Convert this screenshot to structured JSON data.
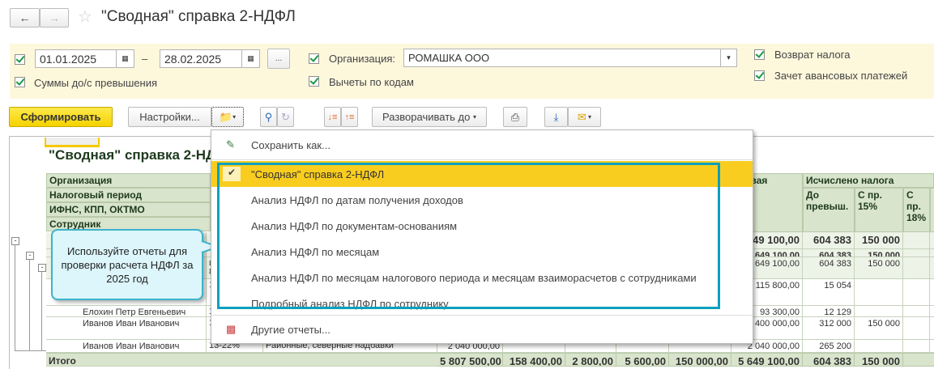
{
  "header": {
    "title": "\"Сводная\" справка 2-НДФЛ",
    "back_icon": "arrow-left",
    "forward_icon": "arrow-right",
    "favorite_icon": "star"
  },
  "filters": {
    "date_from": "01.01.2025",
    "dash": "–",
    "date_to": "28.02.2025",
    "period_button": "...",
    "org_label": "Организация:",
    "org_value": "РОМАШКА ООО",
    "sums_label": "Суммы до/с превышения",
    "deductions_label": "Вычеты по кодам",
    "refund_label": "Возврат налога",
    "advance_label": "Зачет авансовых платежей"
  },
  "toolbar": {
    "generate": "Сформировать",
    "settings": "Настройки...",
    "expand": "Разворачивать до"
  },
  "report": {
    "title": "\"Сводная\" справка 2-НДФЛ",
    "row_headers": [
      "Организация",
      "Налоговый период",
      "ИФНС, КПП, ОКТМО",
      "Сотрудник"
    ],
    "col_header_partial": "оговая",
    "col_header_partial2": "а",
    "tax_header": "Исчислено налога",
    "tax_sub": [
      "До превыш.",
      "С пр. 15%",
      "С пр. 18%"
    ],
    "rows": [
      {
        "name": "",
        "c2": "",
        "c3": "",
        "c1": "",
        "c6": "649 100,00",
        "c7": "604 383",
        "c8": "150 000",
        "bold": true
      },
      {
        "name": "",
        "c2": "",
        "c3": "",
        "c1": "",
        "c6": "5 649 100,00",
        "c7": "604 383",
        "c8": "150 000",
        "bold": true
      },
      {
        "name": "",
        "c2": "ще\n842",
        "c3": "",
        "c1": "",
        "c6": "5 649 100,00",
        "c7": "604 383",
        "c8": "150 000"
      },
      {
        "name": "",
        "c2": "1",
        "c3": "",
        "c1": "",
        "c6": "115 800,00",
        "c7": "15 054",
        "c8": ""
      },
      {
        "name": "Елохин Петр Евгеньевич",
        "c2": "1",
        "c3": "",
        "c1": "",
        "c6": "93 300,00",
        "c7": "12 129",
        "c8": ""
      },
      {
        "name": "Иванов Иван Иванович",
        "c2": "1",
        "c3": "",
        "c1": "",
        "c6": "3 400 000,00",
        "c7": "312 000",
        "c8": "150 000"
      },
      {
        "name": "Иванов Иван Иванович",
        "c2": "13-22%",
        "c3": "Районные, северные надбавки",
        "c1": "2 040 000,00",
        "c6": "2 040 000,00",
        "c7": "265 200",
        "c8": ""
      }
    ],
    "total": {
      "label": "Итого",
      "values": [
        "5 807 500,00",
        "158 400,00",
        "2 800,00",
        "5 600,00",
        "150 000,00",
        "5 649 100,00",
        "604 383",
        "150 000"
      ]
    }
  },
  "dropdown": {
    "save_as": "Сохранить как...",
    "items": [
      "\"Сводная\" справка 2-НДФЛ",
      "Анализ НДФЛ по датам получения доходов",
      "Анализ НДФЛ по документам-основаниям",
      "Анализ НДФЛ по месяцам",
      "Анализ НДФЛ по месяцам налогового периода и месяцам взаиморасчетов с сотрудниками",
      "Подробный анализ НДФЛ по сотруднику"
    ],
    "selected": 0,
    "other": "Другие отчеты..."
  },
  "callout": {
    "text": "Используйте отчеты для проверки расчета НДФЛ за 2025 год"
  },
  "colors": {
    "accent_yellow": "#f9cd1f",
    "highlight_border": "#0aa0c0",
    "table_header": "#d8e4cc",
    "filter_bg": "#fdf8dc"
  }
}
